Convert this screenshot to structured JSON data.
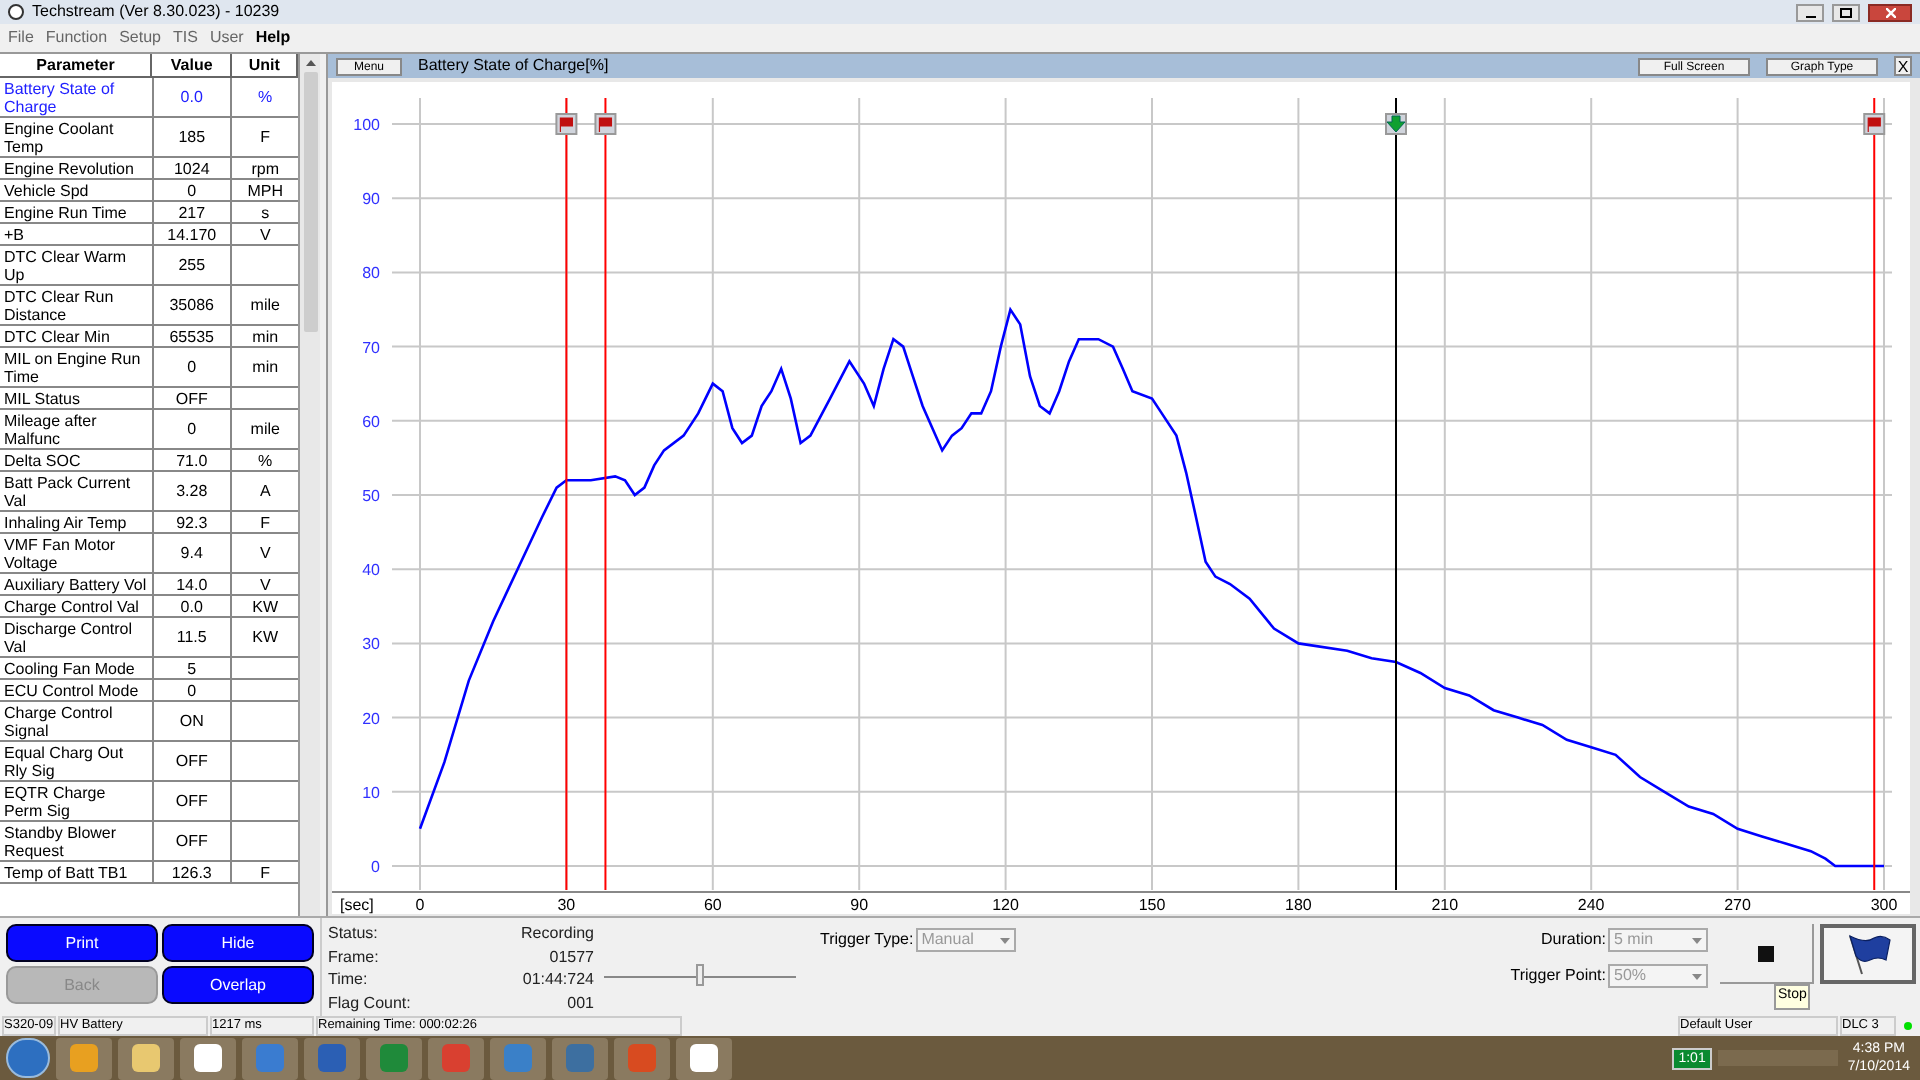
{
  "window": {
    "title": "Techstream (Ver 8.30.023) - 10239"
  },
  "menu": [
    {
      "label": "File",
      "selected": false
    },
    {
      "label": "Function",
      "selected": false
    },
    {
      "label": "Setup",
      "selected": false
    },
    {
      "label": "TIS",
      "selected": false
    },
    {
      "label": "User",
      "selected": false
    },
    {
      "label": "Help",
      "selected": true
    }
  ],
  "table": {
    "columns": [
      "Parameter",
      "Value",
      "Unit"
    ],
    "rows": [
      {
        "parameter": "Battery State of Charge",
        "value": "0.0",
        "unit": "%",
        "selected": true
      },
      {
        "parameter": "Engine Coolant Temp",
        "value": "185",
        "unit": "F",
        "selected": false
      },
      {
        "parameter": "Engine Revolution",
        "value": "1024",
        "unit": "rpm",
        "selected": false
      },
      {
        "parameter": "Vehicle Spd",
        "value": "0",
        "unit": "MPH",
        "selected": false
      },
      {
        "parameter": "Engine Run Time",
        "value": "217",
        "unit": "s",
        "selected": false
      },
      {
        "parameter": "+B",
        "value": "14.170",
        "unit": "V",
        "selected": false
      },
      {
        "parameter": "DTC Clear Warm Up",
        "value": "255",
        "unit": "",
        "selected": false
      },
      {
        "parameter": "DTC Clear Run Distance",
        "value": "35086",
        "unit": "mile",
        "selected": false
      },
      {
        "parameter": "DTC Clear Min",
        "value": "65535",
        "unit": "min",
        "selected": false
      },
      {
        "parameter": "MIL on Engine Run Time",
        "value": "0",
        "unit": "min",
        "selected": false
      },
      {
        "parameter": "MIL Status",
        "value": "OFF",
        "unit": "",
        "selected": false
      },
      {
        "parameter": "Mileage after Malfunc",
        "value": "0",
        "unit": "mile",
        "selected": false
      },
      {
        "parameter": "Delta SOC",
        "value": "71.0",
        "unit": "%",
        "selected": false
      },
      {
        "parameter": "Batt Pack Current Val",
        "value": "3.28",
        "unit": "A",
        "selected": false
      },
      {
        "parameter": "Inhaling Air Temp",
        "value": "92.3",
        "unit": "F",
        "selected": false
      },
      {
        "parameter": "VMF Fan Motor Voltage",
        "value": "9.4",
        "unit": "V",
        "selected": false
      },
      {
        "parameter": "Auxiliary Battery Vol",
        "value": "14.0",
        "unit": "V",
        "selected": false
      },
      {
        "parameter": "Charge Control Val",
        "value": "0.0",
        "unit": "KW",
        "selected": false
      },
      {
        "parameter": "Discharge Control Val",
        "value": "11.5",
        "unit": "KW",
        "selected": false
      },
      {
        "parameter": "Cooling Fan Mode",
        "value": "5",
        "unit": "",
        "selected": false
      },
      {
        "parameter": "ECU Control Mode",
        "value": "0",
        "unit": "",
        "selected": false
      },
      {
        "parameter": "Charge Control Signal",
        "value": "ON",
        "unit": "",
        "selected": false
      },
      {
        "parameter": "Equal Charg Out Rly Sig",
        "value": "OFF",
        "unit": "",
        "selected": false
      },
      {
        "parameter": "EQTR Charge Perm Sig",
        "value": "OFF",
        "unit": "",
        "selected": false
      },
      {
        "parameter": "Standby Blower Request",
        "value": "OFF",
        "unit": "",
        "selected": false
      },
      {
        "parameter": "Temp of Batt TB1",
        "value": "126.3",
        "unit": "F",
        "selected": false
      }
    ]
  },
  "graph": {
    "menu_button": "Menu",
    "title": "Battery State of Charge[%]",
    "buttons": [
      "Full Screen",
      "Graph Type"
    ],
    "close": "X",
    "chart_data": {
      "type": "line",
      "xlabel": "[sec]",
      "xlim": [
        0,
        300
      ],
      "ylim": [
        0,
        100
      ],
      "xticks": [
        0,
        30,
        60,
        90,
        120,
        150,
        180,
        210,
        240,
        270,
        300
      ],
      "yticks": [
        0,
        10,
        20,
        30,
        40,
        50,
        60,
        70,
        80,
        90,
        100
      ],
      "x": [
        0,
        5,
        10,
        15,
        20,
        25,
        28,
        30,
        35,
        40,
        42,
        44,
        46,
        48,
        50,
        54,
        57,
        60,
        62,
        64,
        66,
        68,
        70,
        72,
        74,
        76,
        78,
        80,
        84,
        88,
        91,
        93,
        95,
        97,
        99,
        101,
        103,
        105,
        107,
        109,
        111,
        113,
        115,
        117,
        119,
        121,
        123,
        125,
        127,
        129,
        131,
        133,
        135,
        139,
        142,
        144,
        146,
        150,
        152,
        155,
        157,
        159,
        161,
        163,
        166,
        170,
        175,
        180,
        190,
        195,
        200,
        205,
        210,
        215,
        220,
        225,
        230,
        235,
        240,
        245,
        250,
        255,
        260,
        265,
        270,
        275,
        280,
        285,
        288,
        290,
        300
      ],
      "grid": true,
      "series": [
        {
          "color": "#0000ff",
          "values": [
            5,
            14,
            25,
            33,
            40,
            47,
            51,
            52,
            52,
            52.5,
            52,
            50,
            51,
            54,
            56,
            58,
            61,
            65,
            64,
            59,
            57,
            58,
            62,
            64,
            67,
            63,
            57,
            58,
            63,
            68,
            65,
            62,
            67,
            71,
            70,
            66,
            62,
            59,
            56,
            58,
            59,
            61,
            61,
            64,
            70,
            75,
            73,
            66,
            62,
            61,
            64,
            68,
            71,
            71,
            70,
            67,
            64,
            63,
            61,
            58,
            53,
            47,
            41,
            39,
            38,
            36,
            32,
            30,
            29,
            28,
            27.5,
            26,
            24,
            23,
            21,
            20,
            19,
            17,
            16,
            15,
            12,
            10,
            8,
            7,
            5,
            4,
            3,
            2,
            1,
            0,
            0
          ]
        }
      ],
      "ref_lines": [
        {
          "axis": "x",
          "value": 30,
          "color": "#ff0000"
        },
        {
          "axis": "x",
          "value": 38,
          "color": "#ff0000"
        },
        {
          "axis": "x",
          "value": 200,
          "color": "#000000"
        },
        {
          "axis": "x",
          "value": 298,
          "color": "#ff0000"
        }
      ]
    },
    "cursor_markers": [
      {
        "kind": "flag"
      },
      {
        "kind": "flag"
      },
      {
        "kind": "arrow"
      },
      {
        "kind": "flag"
      }
    ]
  },
  "controls": {
    "buttons": [
      {
        "label": "Print",
        "disabled": false
      },
      {
        "label": "Hide",
        "disabled": false
      },
      {
        "label": "Back",
        "disabled": true
      },
      {
        "label": "Overlap",
        "disabled": false
      }
    ],
    "info": [
      {
        "label": "Status:",
        "value": "Recording"
      },
      {
        "label": "Frame:",
        "value": "01577"
      },
      {
        "label": "Time:",
        "value": "01:44:724"
      },
      {
        "label": "Flag Count:",
        "value": "001"
      }
    ],
    "position_slider": {
      "level": 0.5
    },
    "trigger_type": {
      "label": "Trigger Type:",
      "value": "Manual",
      "disabled": true
    },
    "duration": {
      "label": "Duration:",
      "value": "5 min",
      "disabled": true
    },
    "trigger_point": {
      "label": "Trigger Point:",
      "value": "50%",
      "disabled": true
    },
    "stop_tooltip": "Stop"
  },
  "status_bar": {
    "system": "S320-09",
    "group": "HV Battery",
    "interval": "1217 ms",
    "remaining": "Remaining Time: 000:02:26",
    "user": "Default User",
    "connection": "DLC 3",
    "connected": true
  },
  "taskbar": {
    "battery": "1:01",
    "time": "4:38 PM",
    "date": "7/10/2014"
  }
}
